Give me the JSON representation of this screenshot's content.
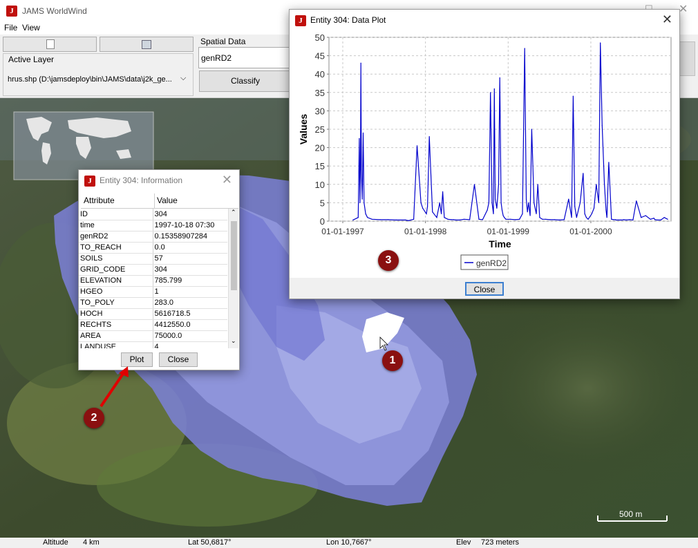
{
  "app": {
    "title": "JAMS WorldWind",
    "menu": [
      "File",
      "View"
    ]
  },
  "toolbar": {
    "active_layer_label": "Active Layer",
    "active_layer_value": "hrus.shp (D:\\jamsdeploy\\bin\\JAMS\\data\\j2k_ge...",
    "spatial_data_label": "Spatial Data",
    "spatial_data_value": "genRD2",
    "classify_label": "Classify"
  },
  "info_window": {
    "title": "Entity 304: Information",
    "columns": [
      "Attribute",
      "Value"
    ],
    "rows": [
      [
        "ID",
        "304"
      ],
      [
        "time",
        "1997-10-18 07:30"
      ],
      [
        "genRD2",
        "0.15358907284"
      ],
      [
        "TO_REACH",
        "0.0"
      ],
      [
        "SOILS",
        "57"
      ],
      [
        "GRID_CODE",
        "304"
      ],
      [
        "ELEVATION",
        "785.799"
      ],
      [
        "HGEO",
        "1"
      ],
      [
        "TO_POLY",
        "283.0"
      ],
      [
        "HOCH",
        "5616718.5"
      ],
      [
        "RECHTS",
        "4412550.0"
      ],
      [
        "AREA",
        "75000.0"
      ],
      [
        "LANDUSE",
        "4"
      ]
    ],
    "plot_label": "Plot",
    "close_label": "Close"
  },
  "plot_window": {
    "title": "Entity 304: Data Plot",
    "close_label": "Close"
  },
  "chart_data": {
    "type": "line",
    "xlabel": "Time",
    "ylabel": "Values",
    "ylim": [
      0,
      50
    ],
    "yticks": [
      0,
      5,
      10,
      15,
      20,
      25,
      30,
      35,
      40,
      45,
      50
    ],
    "xlim": [
      "1996-11-01",
      "2000-12-20"
    ],
    "xticks": [
      {
        "date": "1997-01-01",
        "label": "01-01-1997"
      },
      {
        "date": "1998-01-01",
        "label": "01-01-1998"
      },
      {
        "date": "1999-01-01",
        "label": "01-01-1999"
      },
      {
        "date": "2000-01-01",
        "label": "01-01-2000"
      }
    ],
    "grid": true,
    "legend": "bottom-center",
    "series": [
      {
        "name": "genRD2",
        "color": "#0000cc",
        "x": [
          "1997-02-15",
          "1997-03-10",
          "1997-03-15",
          "1997-03-18",
          "1997-03-20",
          "1997-03-22",
          "1997-03-24",
          "1997-03-28",
          "1997-04-01",
          "1997-04-05",
          "1997-04-12",
          "1997-04-20",
          "1997-05-10",
          "1997-06-15",
          "1997-07-20",
          "1997-08-25",
          "1997-10-05",
          "1997-10-18",
          "1997-11-10",
          "1997-11-25",
          "1997-12-12",
          "1997-12-20",
          "1998-01-05",
          "1998-01-10",
          "1998-01-18",
          "1998-02-01",
          "1998-02-20",
          "1998-03-05",
          "1998-03-12",
          "1998-03-18",
          "1998-03-25",
          "1998-04-10",
          "1998-04-25",
          "1998-05-05",
          "1998-05-15",
          "1998-06-01",
          "1998-06-20",
          "1998-07-15",
          "1998-08-05",
          "1998-08-25",
          "1998-09-10",
          "1998-10-01",
          "1998-10-08",
          "1998-10-15",
          "1998-10-22",
          "1998-10-28",
          "1998-11-01",
          "1998-11-05",
          "1998-11-12",
          "1998-11-20",
          "1998-11-25",
          "1998-12-01",
          "1998-12-05",
          "1998-12-10",
          "1998-12-15",
          "1998-12-22",
          "1999-01-10",
          "1999-02-01",
          "1999-02-20",
          "1999-03-05",
          "1999-03-15",
          "1999-03-22",
          "1999-03-27",
          "1999-04-01",
          "1999-04-08",
          "1999-04-15",
          "1999-04-25",
          "1999-05-05",
          "1999-05-12",
          "1999-05-20",
          "1999-06-01",
          "1999-06-15",
          "1999-07-05",
          "1999-07-25",
          "1999-08-15",
          "1999-09-05",
          "1999-09-25",
          "1999-10-08",
          "1999-10-15",
          "1999-10-22",
          "1999-10-30",
          "1999-11-15",
          "1999-11-28",
          "1999-12-05",
          "1999-12-12",
          "1999-12-20",
          "2000-01-05",
          "2000-01-15",
          "2000-01-25",
          "2000-02-05",
          "2000-02-12",
          "2000-02-20",
          "2000-03-01",
          "2000-03-08",
          "2000-03-12",
          "2000-03-20",
          "2000-04-01",
          "2000-04-10",
          "2000-04-18",
          "2000-04-22",
          "2000-05-01",
          "2000-05-10",
          "2000-05-18",
          "2000-05-25",
          "2000-06-05",
          "2000-06-20",
          "2000-07-05",
          "2000-07-20",
          "2000-08-10",
          "2000-08-30",
          "2000-09-20",
          "2000-10-05",
          "2000-10-10",
          "2000-10-20",
          "2000-11-05",
          "2000-11-20",
          "2000-12-05"
        ],
        "y": [
          0.3,
          1.0,
          22.5,
          5.0,
          15.0,
          43.0,
          14.0,
          6.0,
          24.0,
          5.0,
          2.0,
          1.0,
          0.5,
          0.4,
          0.4,
          0.3,
          0.3,
          0.15,
          0.5,
          20.5,
          5.0,
          3.5,
          2.0,
          4.0,
          23.0,
          2.5,
          1.0,
          5.0,
          2.0,
          8.0,
          1.0,
          0.5,
          0.4,
          0.4,
          0.3,
          0.3,
          0.5,
          0.4,
          10.0,
          0.5,
          0.4,
          3.0,
          5.0,
          35.0,
          5.0,
          2.0,
          36.0,
          6.0,
          3.5,
          10.0,
          39.0,
          5.0,
          3.0,
          1.5,
          1.0,
          0.5,
          0.5,
          0.4,
          0.5,
          2.0,
          47.0,
          6.0,
          2.5,
          5.0,
          1.5,
          25.0,
          5.0,
          2.0,
          10.0,
          1.0,
          0.5,
          0.5,
          0.4,
          0.4,
          0.3,
          0.4,
          6.0,
          1.0,
          34.0,
          4.0,
          1.0,
          5.0,
          13.0,
          2.0,
          1.0,
          0.5,
          2.0,
          3.5,
          10.0,
          5.0,
          48.5,
          26.0,
          10.0,
          3.0,
          1.0,
          16.0,
          0.5,
          0.4,
          0.4,
          0.3,
          0.3,
          0.3,
          0.3,
          0.4,
          0.3,
          0.4,
          0.3,
          5.5,
          1.0,
          1.5,
          0.5,
          0.8,
          0.4,
          0.3,
          0.3,
          1.0,
          0.5
        ]
      }
    ]
  },
  "status": {
    "altitude_label": "Altitude",
    "altitude_value": "4 km",
    "lat": "Lat 50,6817°",
    "lon": "Lon 10,7667°",
    "elev_label": "Elev",
    "elev_value": "723 meters"
  },
  "scale_label": "500 m",
  "badges": [
    "1",
    "2",
    "3"
  ]
}
